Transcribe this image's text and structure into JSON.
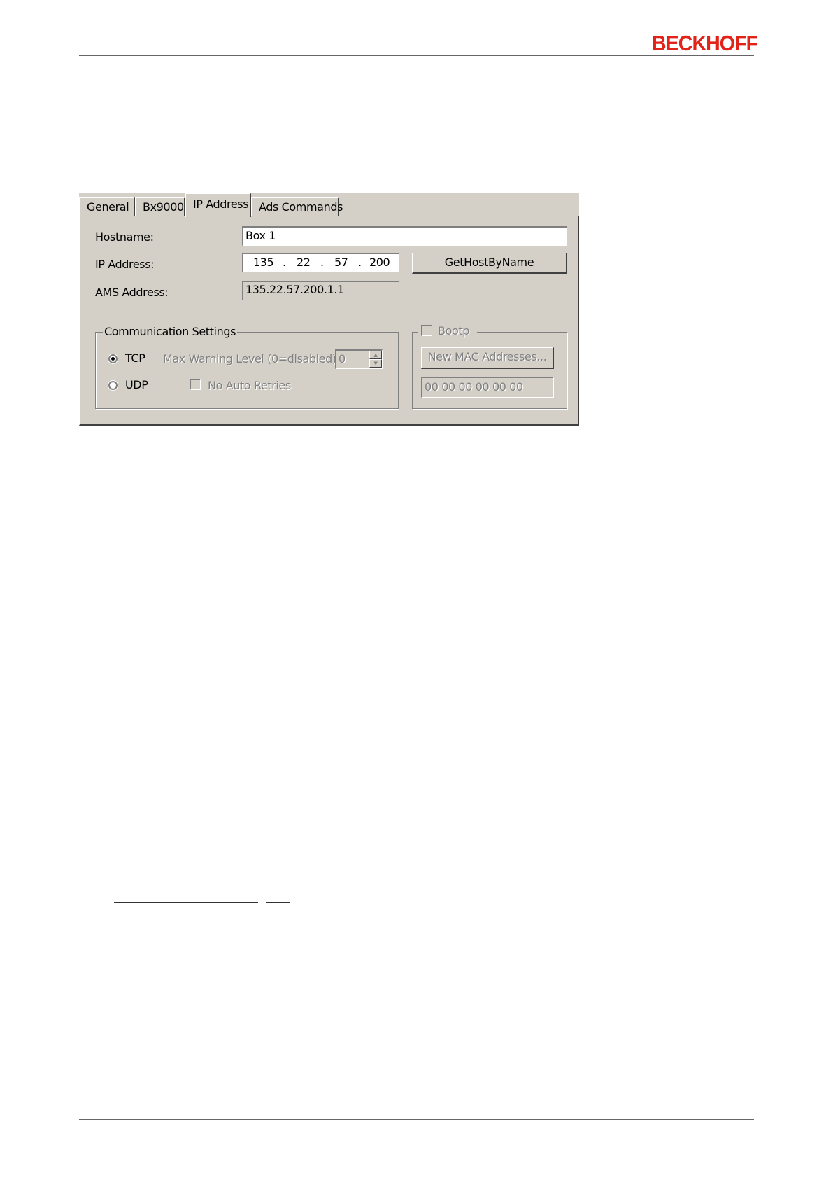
{
  "header": {
    "brand": "BECKHOFF",
    "brand_color": "#e2231a"
  },
  "dialog": {
    "tabs": [
      {
        "label": "General",
        "active": false
      },
      {
        "label": "Bx9000",
        "active": false
      },
      {
        "label": "IP Address",
        "active": true
      },
      {
        "label": "Ads Commands",
        "active": false
      }
    ],
    "hostname": {
      "label": "Hostname:",
      "value": "Box 1"
    },
    "ip_address": {
      "label": "IP Address:",
      "octets": [
        "135",
        "22",
        "57",
        "200"
      ],
      "separator": "."
    },
    "gethostbyname_button": "GetHostByName",
    "ams_address": {
      "label": "AMS Address:",
      "value": "135.22.57.200.1.1"
    },
    "communication": {
      "title": "Communication Settings",
      "tcp_label": "TCP",
      "udp_label": "UDP",
      "selected": "TCP",
      "max_warning_label": "Max Warning Level (0=disabled):",
      "max_warning_value": "0",
      "no_auto_retries_label": "No Auto Retries",
      "no_auto_retries_checked": false
    },
    "bootp": {
      "label": "Bootp",
      "checked": false,
      "new_mac_button": "New MAC Addresses...",
      "mac_value": "00 00 00 00 00 00"
    }
  }
}
